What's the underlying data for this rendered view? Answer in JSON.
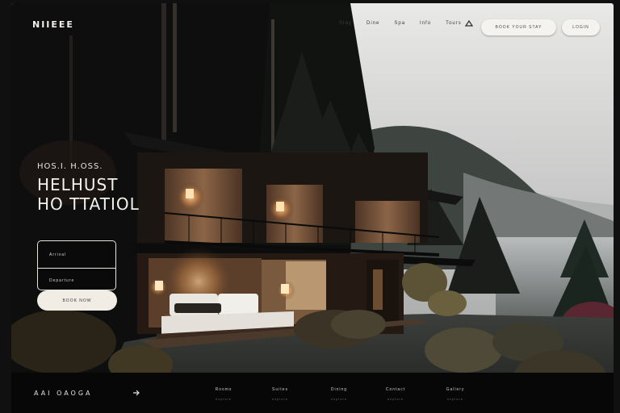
{
  "brand": {
    "logo": "NIIEEE"
  },
  "nav": {
    "links": [
      "Stay",
      "Dine",
      "Spa",
      "Info",
      "Tours"
    ],
    "icon": "mountain-icon",
    "primary_button": "BOOK YOUR STAY",
    "secondary_button": "LOGIN"
  },
  "hero": {
    "eyebrow": "HOS.I. H.OSS.",
    "title_line1": "HELHUST",
    "title_line2": "HO TTATIOL"
  },
  "booking": {
    "field1_placeholder": "Arrival",
    "field2_placeholder": "Departure",
    "cta_label": "BOOK NOW"
  },
  "footer": {
    "brand": "AAI  OAOGA",
    "arrow_icon": "arrow-icon",
    "columns": [
      {
        "title": "Rooms",
        "subtitle": "explore"
      },
      {
        "title": "Suites",
        "subtitle": "explore"
      },
      {
        "title": "Dining",
        "subtitle": "explore"
      },
      {
        "title": "Contact",
        "subtitle": "explore"
      },
      {
        "title": "Gallery",
        "subtitle": "explore"
      }
    ]
  },
  "colors": {
    "background": "#101010",
    "panel_border": "#e7e4de",
    "cta_fill": "#f1ece4",
    "warm_light": "#f2b26b",
    "wood": "#6a4a34"
  }
}
